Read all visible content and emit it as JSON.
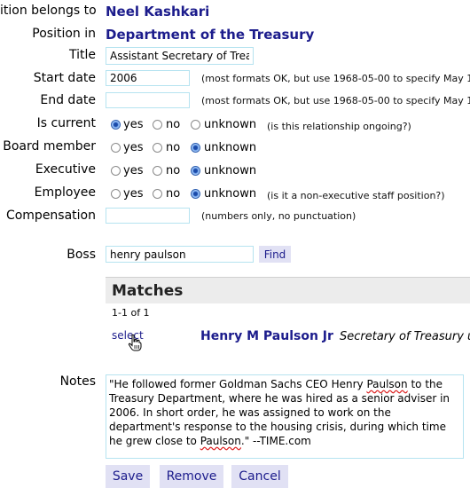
{
  "form": {
    "position_belongs_to": {
      "label": "ition belongs to",
      "value": "Neel Kashkari"
    },
    "position_in": {
      "label": "Position in",
      "value": "Department of the Treasury"
    },
    "title": {
      "label": "Title",
      "value": "Assistant Secretary of Treas"
    },
    "start_date": {
      "label": "Start date",
      "value": "2006",
      "hint": "(most formats OK, but use 1968-05-00 to specify May 1"
    },
    "end_date": {
      "label": "End date",
      "value": "",
      "hint": "(most formats OK, but use 1968-05-00 to specify May 1"
    },
    "is_current": {
      "label": "Is current",
      "hint": "(is this relationship ongoing?)",
      "selected": "yes"
    },
    "board_member": {
      "label": "Board member",
      "selected": "unknown"
    },
    "executive": {
      "label": "Executive",
      "selected": "unknown"
    },
    "employee": {
      "label": "Employee",
      "hint": "(is it a non-executive staff position?)",
      "selected": "unknown"
    },
    "compensation": {
      "label": "Compensation",
      "value": "",
      "hint": "(numbers only, no punctuation)"
    },
    "radio_options": {
      "yes": "yes",
      "no": "no",
      "unknown": "unknown"
    },
    "boss": {
      "label": "Boss",
      "value": "henry paulson",
      "find_label": "Find"
    },
    "matches": {
      "heading": "Matches",
      "count": "1-1 of 1",
      "results": [
        {
          "select_label": "select",
          "name": "Henry M Paulson Jr",
          "description": "Secretary of Treasury u"
        }
      ]
    },
    "notes": {
      "label": "Notes",
      "text_1": "\"He followed former Goldman Sachs CEO Henry ",
      "text_2": "Paulson",
      "text_3": " to the Treasury Department, where he was hired as a senior adviser in 2006. In short order, he was assigned to work on the department's response to the housing crisis, during which time he grew close to ",
      "text_4": "Paulson",
      "text_5": ".\" --TIME.com"
    },
    "buttons": {
      "save": "Save",
      "remove": "Remove",
      "cancel": "Cancel"
    }
  },
  "colors": {
    "link": "#1c1c8c",
    "input_border": "#b6e3f0",
    "button_bg": "#e1e1f4",
    "matches_bg": "#ececec"
  },
  "icons": {
    "cursor": "hand-pointer-icon"
  }
}
